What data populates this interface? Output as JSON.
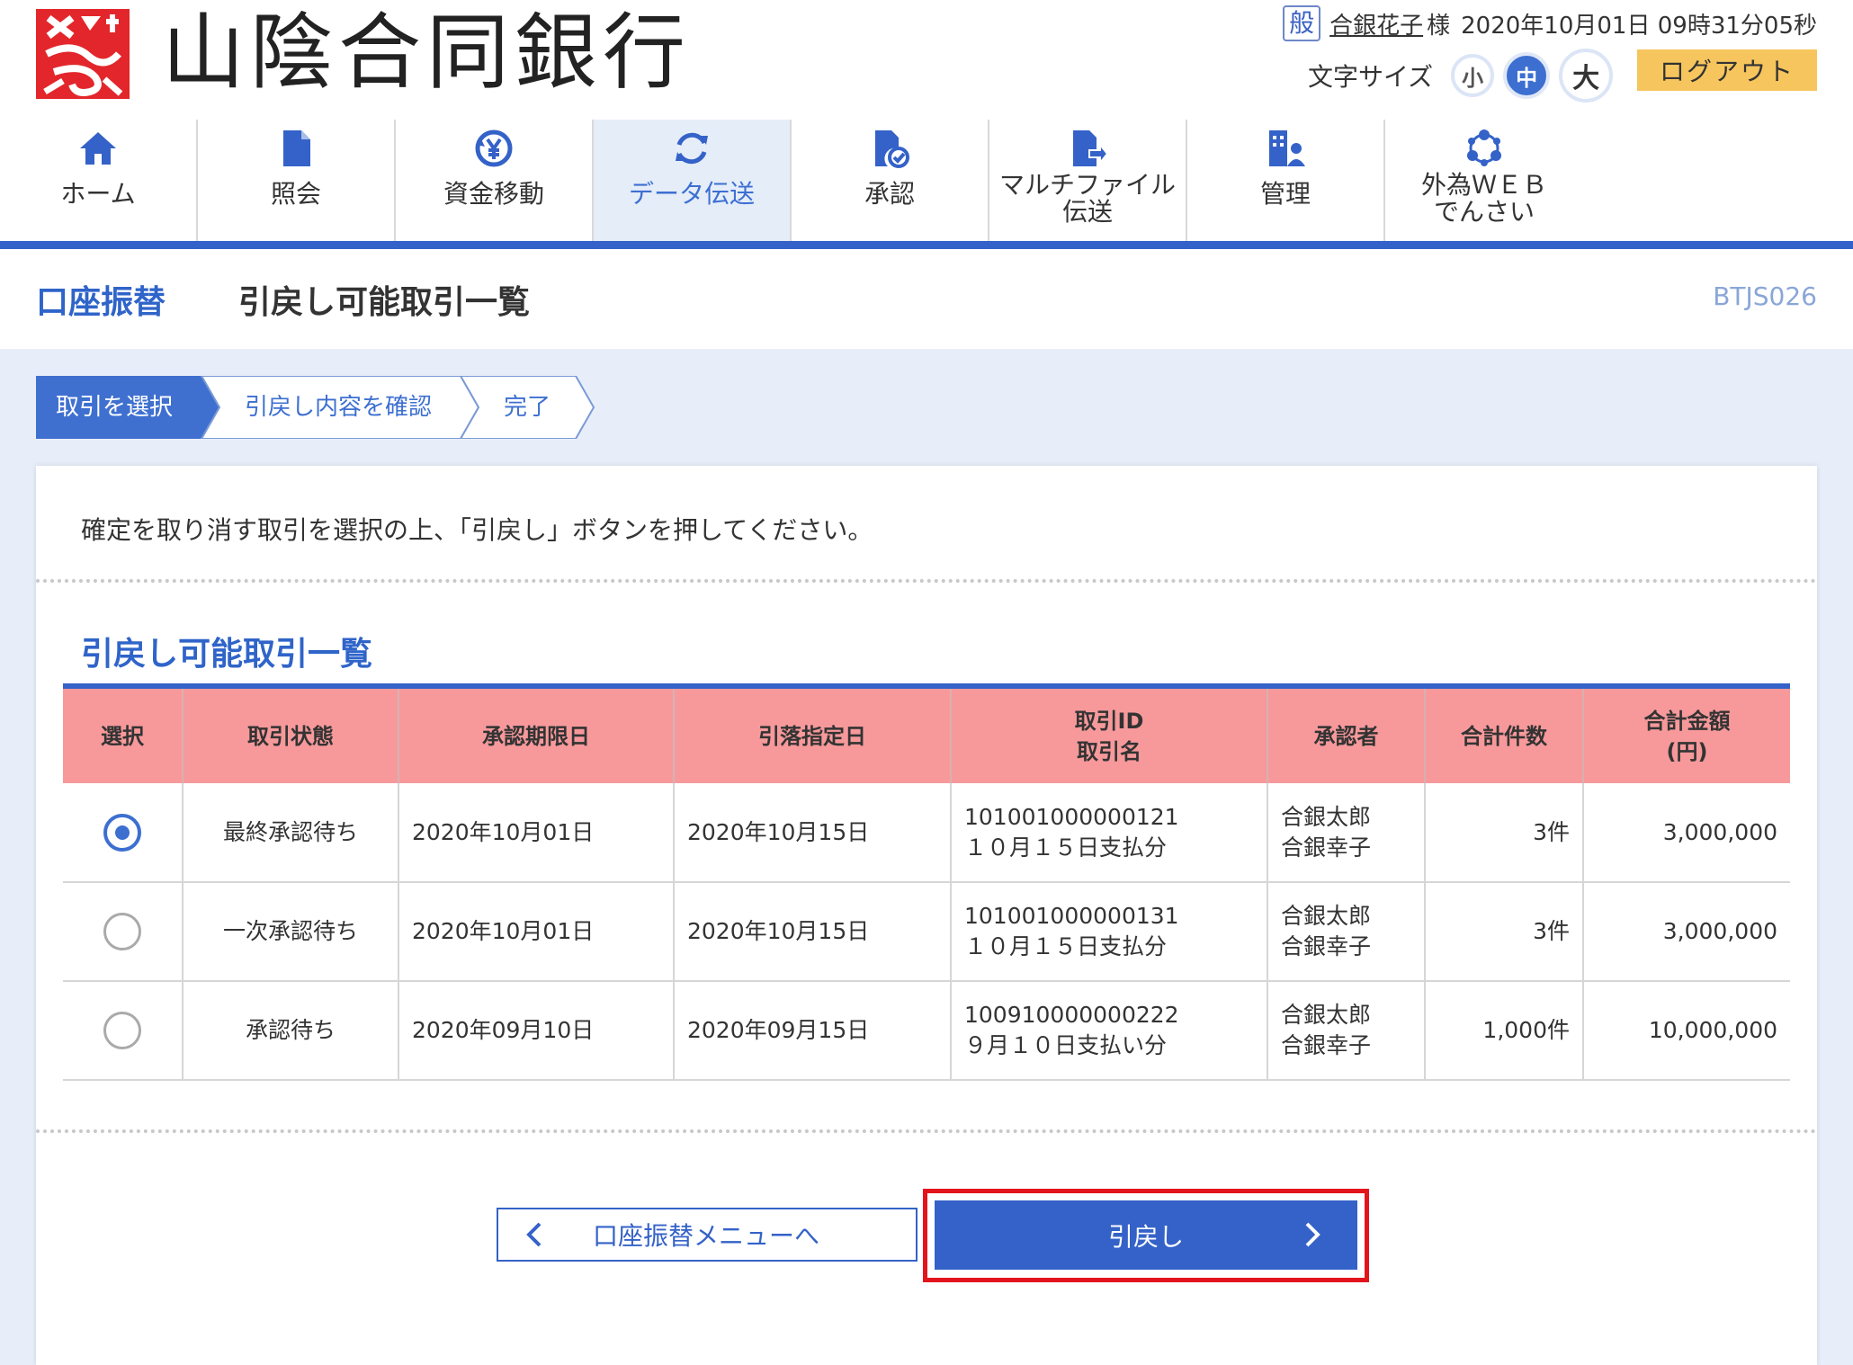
{
  "header": {
    "bank_name": "山陰合同銀行",
    "user_kind": "般",
    "user_name": "合銀花子",
    "user_suffix": "様",
    "datetime": "2020年10月01日 09時31分05秒",
    "font_size_label": "文字サイズ",
    "font_size_options": [
      "小",
      "中",
      "大"
    ],
    "font_size_selected": "中",
    "logout_label": "ログアウト",
    "brand_color": "#3462c8",
    "logo_color": "#e3262b"
  },
  "nav": {
    "items": [
      {
        "label": "ホーム",
        "icon": "home-icon"
      },
      {
        "label": "照会",
        "icon": "document-icon"
      },
      {
        "label": "資金移動",
        "icon": "yen-transfer-icon"
      },
      {
        "label": "データ伝送",
        "icon": "sync-icon"
      },
      {
        "label": "承認",
        "icon": "approval-icon"
      },
      {
        "label": "マルチファイル",
        "label2": "伝送",
        "icon": "file-transfer-icon"
      },
      {
        "label": "管理",
        "icon": "management-icon"
      },
      {
        "label": "外為ＷＥＢ",
        "label2": "でんさい",
        "icon": "network-icon"
      }
    ],
    "active_index": 3
  },
  "title": {
    "section": "口座振替",
    "page": "引戻し可能取引一覧",
    "screen_id": "BTJS026"
  },
  "steps": [
    "取引を選択",
    "引戻し内容を確認",
    "完了"
  ],
  "active_step": 0,
  "instruction": "確定を取り消す取引を選択の上、「引戻し」ボタンを押してください。",
  "list_heading": "引戻し可能取引一覧",
  "table": {
    "headers": {
      "select": "選択",
      "status": "取引状態",
      "approval_deadline": "承認期限日",
      "debit_date": "引落指定日",
      "tx_id": "取引ID",
      "tx_name": "取引名",
      "approver": "承認者",
      "total_count": "合計件数",
      "total_amount": "合計金額",
      "total_amount_unit": "(円)"
    },
    "rows": [
      {
        "selected": true,
        "status": "最終承認待ち",
        "approval_deadline": "2020年10月01日",
        "debit_date": "2020年10月15日",
        "tx_id": "101001000000121",
        "tx_name": "１０月１５日支払分",
        "approver1": "合銀太郎",
        "approver2": "合銀幸子",
        "total_count": "3件",
        "total_amount": "3,000,000"
      },
      {
        "selected": false,
        "status": "一次承認待ち",
        "approval_deadline": "2020年10月01日",
        "debit_date": "2020年10月15日",
        "tx_id": "101001000000131",
        "tx_name": "１０月１５日支払分",
        "approver1": "合銀太郎",
        "approver2": "合銀幸子",
        "total_count": "3件",
        "total_amount": "3,000,000"
      },
      {
        "selected": false,
        "status": "承認待ち",
        "approval_deadline": "2020年09月10日",
        "debit_date": "2020年09月15日",
        "tx_id": "100910000000222",
        "tx_name": "９月１０日支払い分",
        "approver1": "合銀太郎",
        "approver2": "合銀幸子",
        "total_count": "1,000件",
        "total_amount": "10,000,000"
      }
    ]
  },
  "buttons": {
    "back_label": "口座振替メニューへ",
    "submit_label": "引戻し"
  }
}
